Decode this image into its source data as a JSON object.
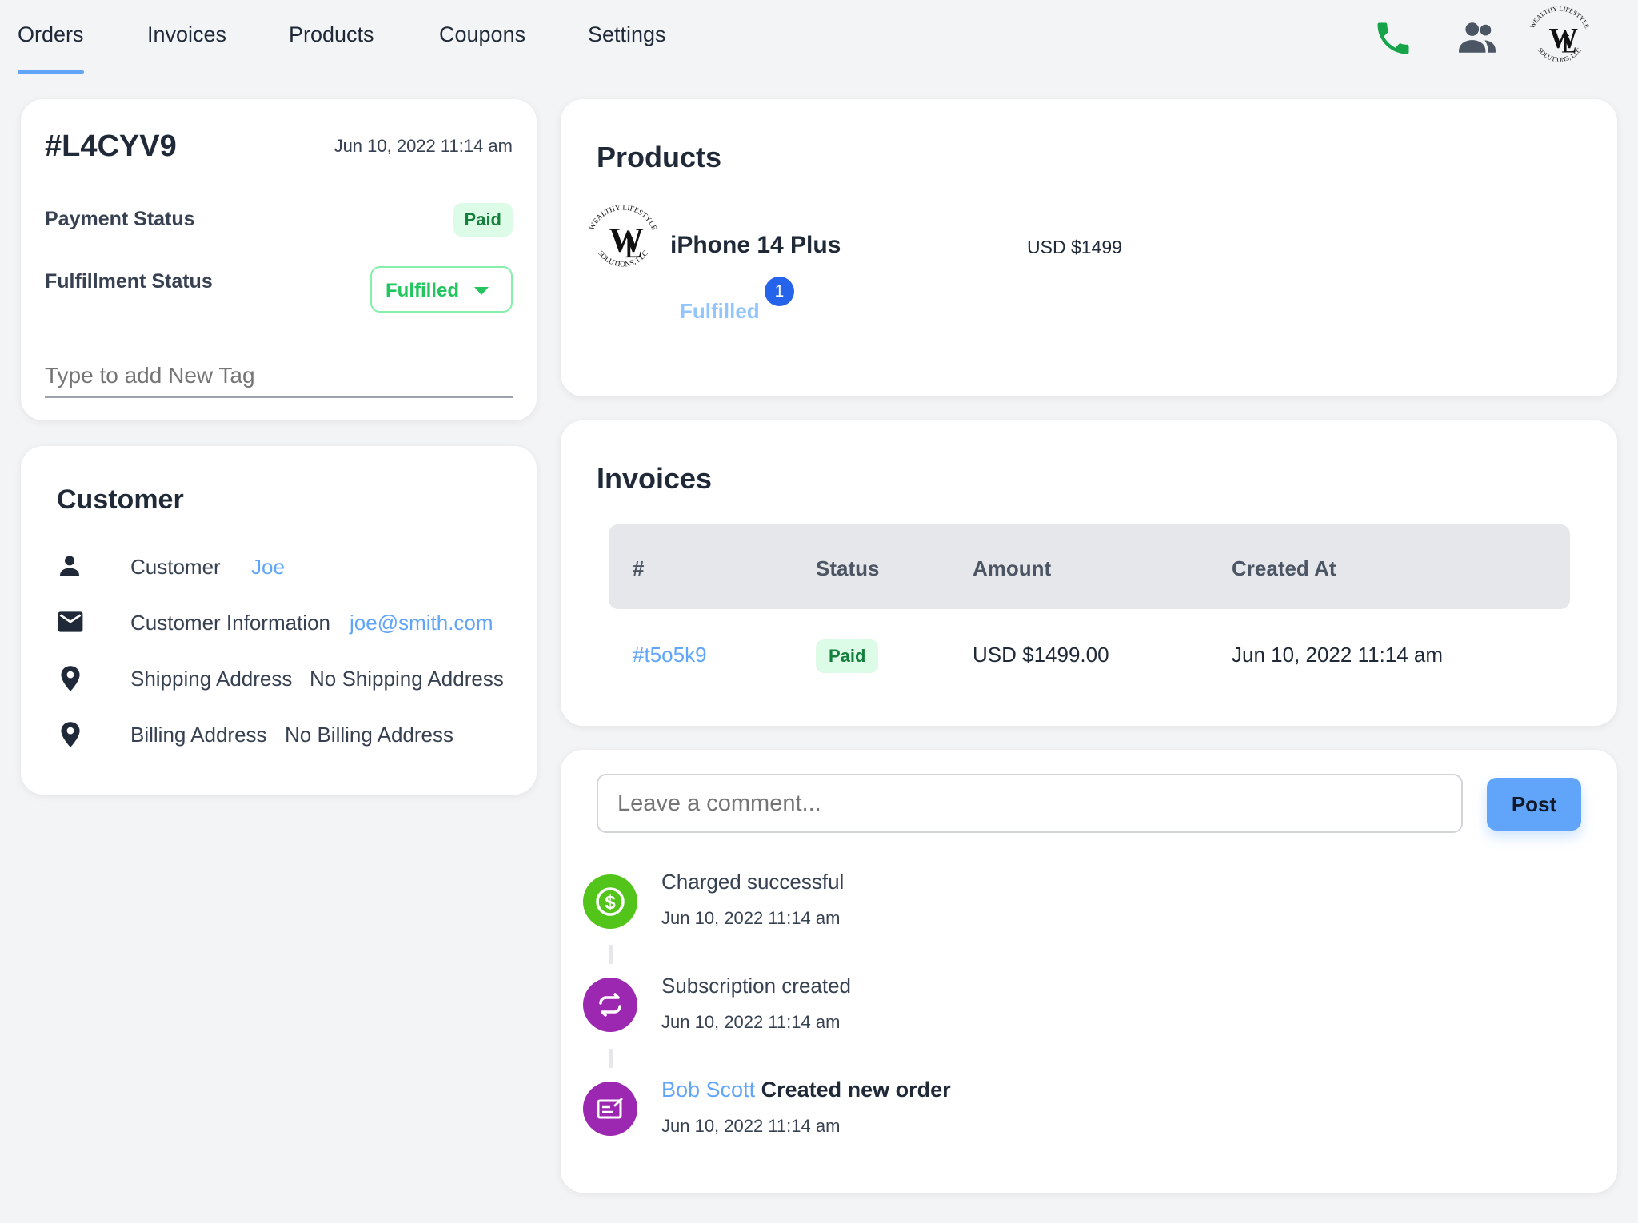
{
  "nav": {
    "tabs": [
      "Orders",
      "Invoices",
      "Products",
      "Coupons",
      "Settings"
    ],
    "active_tab": "Orders",
    "icons": [
      "phone-icon",
      "users-icon",
      "logo"
    ]
  },
  "logo": {
    "top_text": "WEALTHY LIFESTYLE",
    "bottom_text": "SOLUTIONS, LLC",
    "monogram_w": "W",
    "monogram_l": "L"
  },
  "order": {
    "id": "#L4CYV9",
    "date": "Jun 10, 2022 11:14 am",
    "payment_status_label": "Payment Status",
    "payment_status": "Paid",
    "fulfillment_status_label": "Fulfillment Status",
    "fulfillment_status": "Fulfilled",
    "tag_placeholder": "Type to add New Tag"
  },
  "customer": {
    "title": "Customer",
    "rows": [
      {
        "icon": "person-icon",
        "label": "Customer",
        "value": "Joe"
      },
      {
        "icon": "mail-icon",
        "label": "Customer Information",
        "value": "joe@smith.com"
      },
      {
        "icon": "map-pin-icon",
        "label": "Shipping Address",
        "value": "No Shipping Address"
      },
      {
        "icon": "map-pin-icon",
        "label": "Billing Address",
        "value": "No Billing Address"
      }
    ]
  },
  "products": {
    "title": "Products",
    "items": [
      {
        "name": "iPhone 14 Plus",
        "price": "USD $1499",
        "status": "Fulfilled",
        "quantity": "1"
      }
    ]
  },
  "invoices": {
    "title": "Invoices",
    "columns": [
      "#",
      "Status",
      "Amount",
      "Created At"
    ],
    "rows": [
      {
        "id": "#t5o5k9",
        "status": "Paid",
        "amount": "USD $1499.00",
        "created_at": "Jun 10, 2022 11:14 am"
      }
    ]
  },
  "comments": {
    "placeholder": "Leave a comment...",
    "post_label": "Post"
  },
  "timeline": [
    {
      "icon": "dollar-icon",
      "color": "#52c41a",
      "actor": "",
      "title": "Charged successful",
      "date": "Jun 10, 2022 11:14 am"
    },
    {
      "icon": "repeat-icon",
      "color": "#9c27b0",
      "actor": "",
      "title": "Subscription created",
      "date": "Jun 10, 2022 11:14 am"
    },
    {
      "icon": "order-icon",
      "color": "#9c27b0",
      "actor": "Bob Scott",
      "title": "Created new order",
      "date": "Jun 10, 2022 11:14 am"
    }
  ],
  "colors": {
    "accent": "#60a5fa",
    "paid_bg": "#dcfce7",
    "paid_text": "#15803d",
    "fulfilled": "#22c55e",
    "phone": "#16a34a",
    "badge_blue": "#2563eb"
  }
}
